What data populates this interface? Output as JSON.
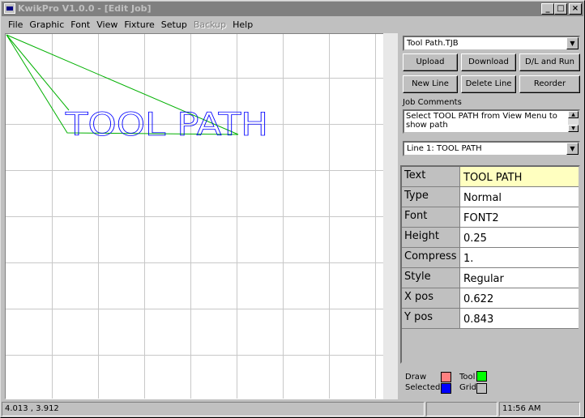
{
  "window": {
    "title": "KwikPro  V1.0.0 - [Edit Job]",
    "controls": {
      "minimize": "_",
      "maximize": "□",
      "close": "×"
    }
  },
  "menu": {
    "items": [
      {
        "label": "File",
        "disabled": false
      },
      {
        "label": "Graphic",
        "disabled": false
      },
      {
        "label": "Font",
        "disabled": false
      },
      {
        "label": "View",
        "disabled": false
      },
      {
        "label": "Fixture",
        "disabled": false
      },
      {
        "label": "Setup",
        "disabled": false
      },
      {
        "label": "Backup",
        "disabled": true
      },
      {
        "label": "Help",
        "disabled": false
      }
    ]
  },
  "canvas": {
    "preview_text": "TOOL PATH",
    "grid_color": "#c8c8c8",
    "text_color": "#0000ff",
    "path_color": "#00b000"
  },
  "panel": {
    "file_combo": "Tool Path.TJB",
    "buttons": {
      "upload": "Upload",
      "download": "Download",
      "dl_run": "D/L and Run",
      "new_line": "New Line",
      "delete_line": "Delete Line",
      "reorder": "Reorder"
    },
    "job_comments_label": "Job Comments",
    "job_comments": "Select TOOL PATH from View Menu to show path",
    "line_combo": "Line 1: TOOL PATH"
  },
  "properties": [
    {
      "name": "Text",
      "value": "TOOL PATH"
    },
    {
      "name": "Type",
      "value": "Normal"
    },
    {
      "name": "Font",
      "value": "FONT2"
    },
    {
      "name": "Height",
      "value": "0.25"
    },
    {
      "name": "Compress",
      "value": "1."
    },
    {
      "name": "Style",
      "value": "Regular"
    },
    {
      "name": "X pos",
      "value": "0.622"
    },
    {
      "name": "Y pos",
      "value": "0.843"
    }
  ],
  "legend": {
    "draw": "Draw",
    "tool": "Tool",
    "selected": "Selected",
    "grid": "Grid",
    "colors": {
      "draw": "#ff8080",
      "tool": "#00ff00",
      "selected": "#0000ff",
      "grid": "#c0c0c0"
    }
  },
  "status": {
    "coords": "4.013 , 3.912",
    "time": "11:56 AM"
  }
}
